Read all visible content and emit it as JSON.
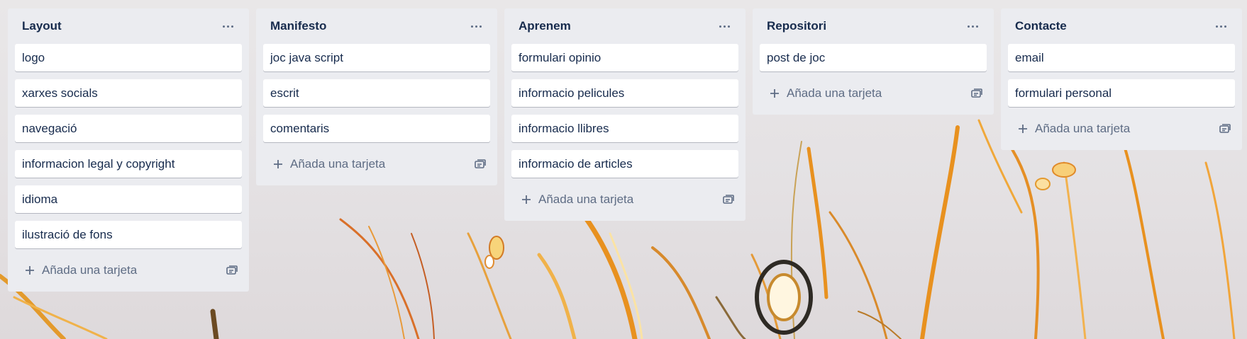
{
  "board": {
    "add_card_label": "Añada una tarjeta",
    "lists": [
      {
        "title": "Layout",
        "cards": [
          "logo",
          "xarxes socials",
          "navegació",
          "informacion legal y copyright",
          "idioma",
          "ilustració de fons"
        ]
      },
      {
        "title": "Manifesto",
        "cards": [
          "joc java script",
          "escrit",
          "comentaris"
        ]
      },
      {
        "title": "Aprenem",
        "cards": [
          "formulari opinio",
          "informacio pelicules",
          "informacio llibres",
          "informacio de articles"
        ]
      },
      {
        "title": "Repositori",
        "cards": [
          "post de joc"
        ]
      },
      {
        "title": "Contacte",
        "cards": [
          "email",
          "formulari personal"
        ]
      }
    ]
  },
  "icons": {
    "list_menu": "ellipsis-icon",
    "add_card": "plus-icon",
    "card_template": "template-icon"
  },
  "colors": {
    "list_background": "#ebecf0",
    "card_background": "#ffffff",
    "title_text": "#172b4d",
    "muted_text": "#5e6c84",
    "accent_orange": "#e8911f"
  }
}
